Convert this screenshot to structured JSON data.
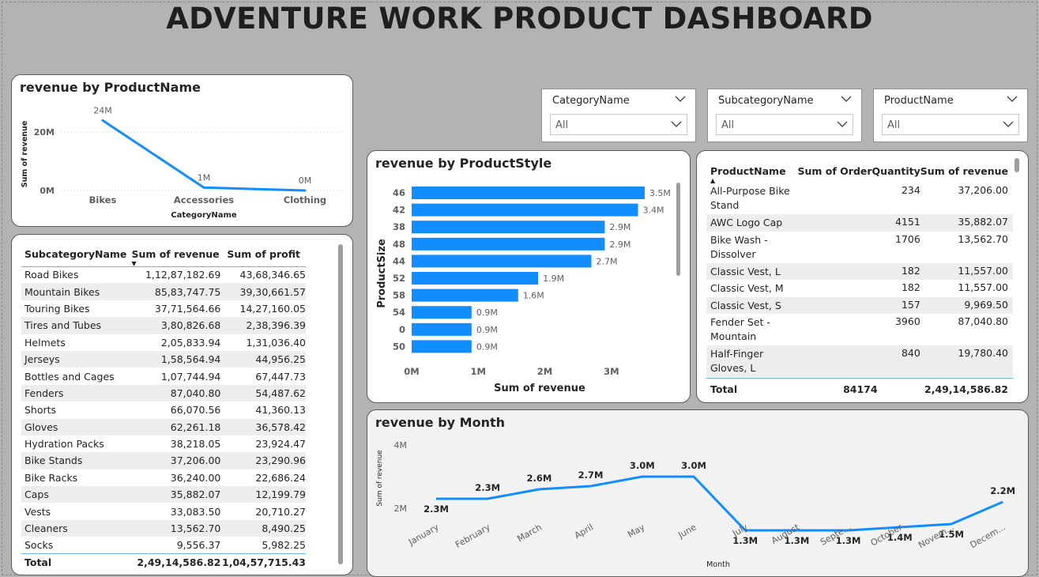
{
  "dashboard_title": "ADVENTURE WORK PRODUCT DASHBOARD",
  "colors": {
    "accent": "#118DFF",
    "background": "#B3B3B3",
    "alt_row": "#EDEDED"
  },
  "slicers": [
    {
      "label": "CategoryName",
      "value": "All",
      "icon": "chevron-down-icon"
    },
    {
      "label": "SubcategoryName",
      "value": "All",
      "icon": "chevron-down-icon"
    },
    {
      "label": "ProductName",
      "value": "All",
      "icon": "chevron-down-icon"
    }
  ],
  "category_chart": {
    "title": "revenue by ProductName",
    "chart_data": {
      "type": "line",
      "categories": [
        "Bikes",
        "Accessories",
        "Clothing"
      ],
      "values": [
        24,
        1,
        0
      ],
      "data_labels": [
        "24M",
        "1M",
        "0M"
      ],
      "xlabel": "CategoryName",
      "ylabel": "Sum of revenue",
      "y_ticks": [
        "0M",
        "20M"
      ],
      "ylim": [
        0,
        26
      ]
    }
  },
  "subcategory_table": {
    "columns": [
      "SubcategoryName",
      "Sum of revenue",
      "Sum of profit"
    ],
    "rows": [
      [
        "Road Bikes",
        "1,12,87,182.69",
        "43,68,346.65"
      ],
      [
        "Mountain Bikes",
        "85,83,747.75",
        "39,30,661.57"
      ],
      [
        "Touring Bikes",
        "37,71,564.66",
        "14,27,160.05"
      ],
      [
        "Tires and Tubes",
        "3,80,826.68",
        "2,38,396.39"
      ],
      [
        "Helmets",
        "2,05,833.94",
        "1,31,036.40"
      ],
      [
        "Jerseys",
        "1,58,564.94",
        "44,956.25"
      ],
      [
        "Bottles and Cages",
        "1,07,744.94",
        "67,447.73"
      ],
      [
        "Fenders",
        "87,040.80",
        "54,487.62"
      ],
      [
        "Shorts",
        "66,070.56",
        "41,360.13"
      ],
      [
        "Gloves",
        "62,261.18",
        "36,578.42"
      ],
      [
        "Hydration Packs",
        "38,218.05",
        "23,924.47"
      ],
      [
        "Bike Stands",
        "37,206.00",
        "23,290.96"
      ],
      [
        "Bike Racks",
        "36,240.00",
        "22,686.24"
      ],
      [
        "Caps",
        "35,882.07",
        "12,199.79"
      ],
      [
        "Vests",
        "33,083.50",
        "20,710.27"
      ],
      [
        "Cleaners",
        "13,562.70",
        "8,490.25"
      ],
      [
        "Socks",
        "9,556.37",
        "5,982.25"
      ]
    ],
    "total": [
      "Total",
      "2,49,14,586.82",
      "1,04,57,715.43"
    ]
  },
  "style_chart": {
    "title": "revenue by ProductStyle",
    "chart_data": {
      "type": "bar",
      "orientation": "horizontal",
      "categories": [
        "46",
        "42",
        "38",
        "48",
        "44",
        "52",
        "58",
        "54",
        "0",
        "50"
      ],
      "values": [
        3.5,
        3.4,
        2.9,
        2.9,
        2.7,
        1.9,
        1.6,
        0.9,
        0.9,
        0.9
      ],
      "data_labels": [
        "3.5M",
        "3.4M",
        "2.9M",
        "2.9M",
        "2.7M",
        "1.9M",
        "1.6M",
        "0.9M",
        "0.9M",
        "0.9M"
      ],
      "xlabel": "Sum of revenue",
      "ylabel": "ProductSize",
      "x_ticks": [
        "0M",
        "1M",
        "2M",
        "3M"
      ],
      "xlim": [
        0,
        3.6
      ]
    }
  },
  "product_table": {
    "columns": [
      "ProductName",
      "Sum of OrderQuantity",
      "Sum of revenue"
    ],
    "rows": [
      [
        "All-Purpose Bike|Stand",
        "234",
        "37,206.00"
      ],
      [
        "AWC Logo Cap",
        "4151",
        "35,882.07"
      ],
      [
        "Bike Wash -|Dissolver",
        "1706",
        "13,562.70"
      ],
      [
        "Classic Vest, L",
        "182",
        "11,557.00"
      ],
      [
        "Classic Vest, M",
        "182",
        "11,557.00"
      ],
      [
        "Classic Vest, S",
        "157",
        "9,969.50"
      ],
      [
        "Fender Set -|Mountain",
        "3960",
        "87,040.80"
      ],
      [
        "Half-Finger|Gloves, L",
        "840",
        "19,780.40"
      ]
    ],
    "total": [
      "Total",
      "84174",
      "2,49,14,586.82"
    ]
  },
  "month_chart": {
    "title": "revenue by Month",
    "chart_data": {
      "type": "line",
      "categories": [
        "January",
        "February",
        "March",
        "April",
        "May",
        "June",
        "July",
        "August",
        "Septe...",
        "October",
        "Novem...",
        "Decem..."
      ],
      "values": [
        2.3,
        2.3,
        2.6,
        2.7,
        3.0,
        3.0,
        1.3,
        1.3,
        1.3,
        1.4,
        1.5,
        2.2
      ],
      "data_labels": [
        "2.3M",
        "2.3M",
        "2.6M",
        "2.7M",
        "3.0M",
        "3.0M",
        "1.3M",
        "1.3M",
        "1.3M",
        "1.4M",
        "1.5M",
        "2.2M"
      ],
      "xlabel": "Month",
      "ylabel": "Sum of revenue",
      "y_ticks": [
        "2M",
        "4M"
      ],
      "ylim": [
        0.9,
        4.1
      ]
    }
  }
}
